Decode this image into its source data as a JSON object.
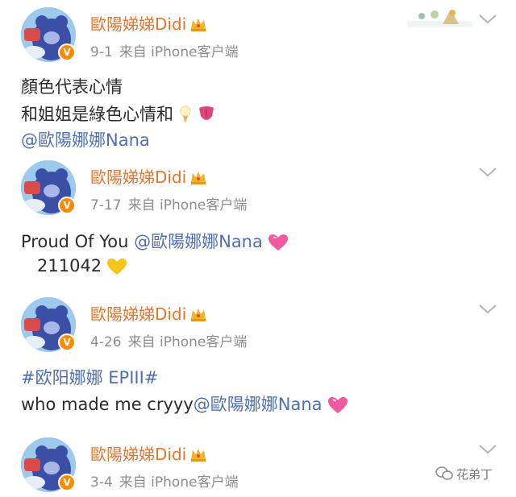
{
  "posts": [
    {
      "name": "歐陽娣娣Didi",
      "date": "9-1",
      "source": "来自 iPhone客户端",
      "lines": [
        "顏色代表心情",
        "和姐姐是綠色心情和"
      ],
      "mention": "@歐陽娜娜Nana"
    },
    {
      "name": "歐陽娣娣Didi",
      "date": "7-17",
      "source": "来自 iPhone客户端",
      "text": "Proud Of You ",
      "mention": "@歐陽娜娜Nana",
      "number": "211042"
    },
    {
      "name": "歐陽娣娣Didi",
      "date": "4-26",
      "source": "来自 iPhone客户端",
      "topic": "#欧阳娜娜 EPIII#",
      "text": "who made me cryyy",
      "mention": "@歐陽娜娜Nana"
    },
    {
      "name": "歐陽娣娣Didi",
      "date": "3-4",
      "source": "来自 iPhone客户端"
    }
  ],
  "watermark": "花弟丁",
  "verified_badge": "V",
  "colors": {
    "name": "#e8742c",
    "link": "#4e6fb7",
    "meta": "#8c8c8c",
    "badge": "#ff8a00"
  },
  "icons": [
    "crown-icon",
    "chevron-down-icon",
    "ice-cream-icon",
    "tongue-icon",
    "pink-heart-icon",
    "yellow-heart-icon",
    "wechat-icon"
  ]
}
